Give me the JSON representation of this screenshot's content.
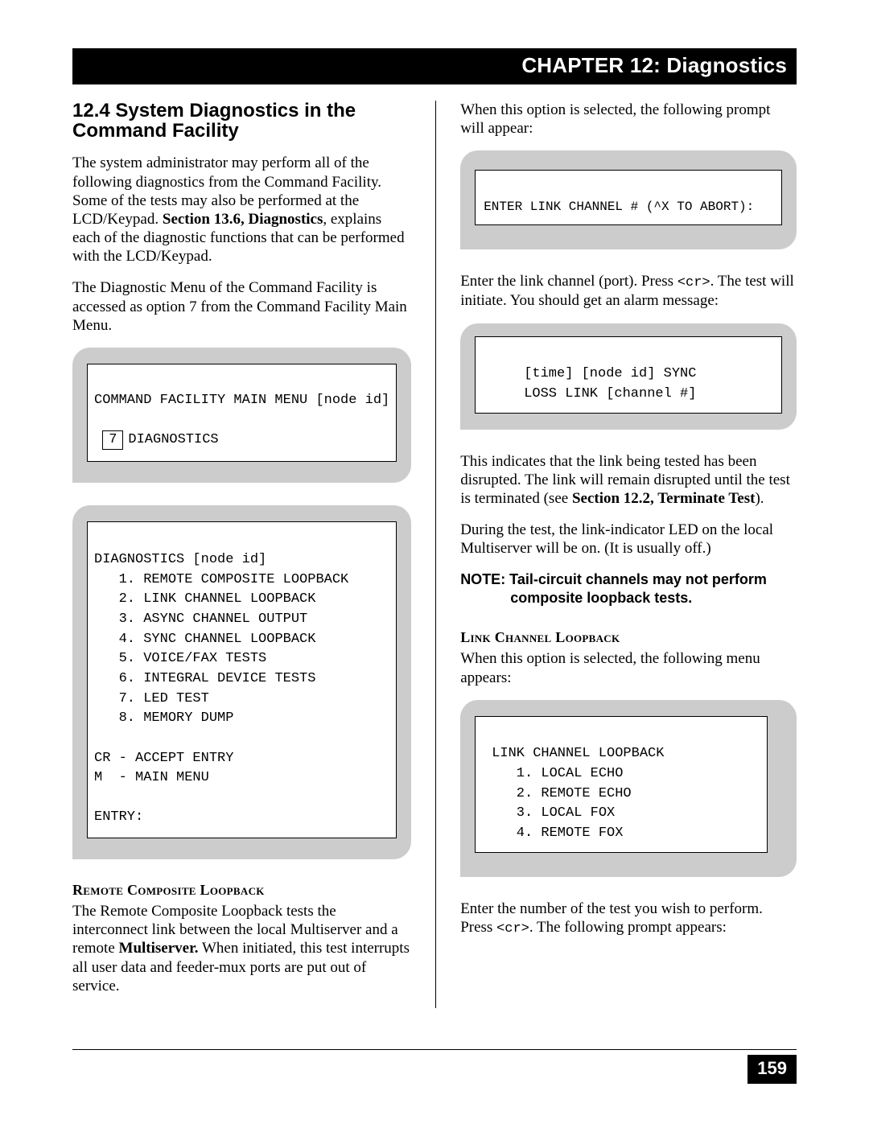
{
  "chapter_bar": "CHAPTER 12: Diagnostics",
  "section_title": "12.4  System Diagnostics in the Command Facility",
  "left": {
    "p1_a": "The system administrator may perform all of the following diagnostics from the Command Facility. Some of the tests may also be performed at the LCD/Keypad.  ",
    "p1_bold": "Section 13.6, Diagnostics",
    "p1_b": ", explains each of the diagnostic functions that can be performed with the LCD/Keypad.",
    "p2": "The Diagnostic Menu of the Command Facility is accessed as option 7 from the Command Facility Main Menu.",
    "box1_line1": "COMMAND FACILITY MAIN MENU [node id]",
    "box1_opt": "7",
    "box1_opt_label": "DIAGNOSTICS",
    "box2_title": "DIAGNOSTICS [node id]",
    "box2_items": [
      "1. REMOTE COMPOSITE LOOPBACK",
      "2. LINK CHANNEL LOOPBACK",
      "3. ASYNC CHANNEL OUTPUT",
      "4. SYNC CHANNEL LOOPBACK",
      "5. VOICE/FAX TESTS",
      "6. INTEGRAL DEVICE TESTS",
      "7. LED TEST",
      "8. MEMORY DUMP"
    ],
    "box2_cr": "CR - ACCEPT ENTRY",
    "box2_m": "M  - MAIN MENU",
    "box2_entry": "ENTRY:",
    "sub1": "Remote Composite Loopback",
    "p3_a": "The Remote Composite Loopback tests the interconnect link between the local Multiserver and a remote ",
    "p3_bold": "Multiserver.",
    "p3_b": "  When initiated, this test interrupts all user data and feeder-mux ports are put out of service."
  },
  "right": {
    "p1": "When this option is selected, the following prompt will appear:",
    "box1": "ENTER LINK CHANNEL # (^X TO ABORT):",
    "p2_a": "Enter the link channel (port).  Press ",
    "p2_mono": "<cr>",
    "p2_b": ".  The test will initiate.  You should get an alarm message:",
    "box2_l1": "[time] [node id] SYNC",
    "box2_l2": "LOSS LINK [channel #]",
    "p3_a": "This indicates that the link being tested has been disrupted.  The link will remain disrupted until the test is terminated (see ",
    "p3_bold": "Section 12.2, Terminate Test",
    "p3_b": ").",
    "p4": "During the test, the link-indicator LED on the local Multiserver will be on.  (It is usually off.)",
    "note_a": "NOTE:  Tail-circuit channels may not perform",
    "note_b": "composite loopback tests.",
    "sub1": "Link Channel Loopback",
    "p5": "When this option is selected, the following menu appears:",
    "box3_title": "LINK CHANNEL LOOPBACK",
    "box3_items": [
      "1. LOCAL ECHO",
      "2. REMOTE ECHO",
      "3. LOCAL FOX",
      "4. REMOTE FOX"
    ],
    "p6_a": "Enter the number of the test you wish to perform.  Press ",
    "p6_mono": "<cr>",
    "p6_b": ".  The following prompt appears:"
  },
  "page_number": "159"
}
